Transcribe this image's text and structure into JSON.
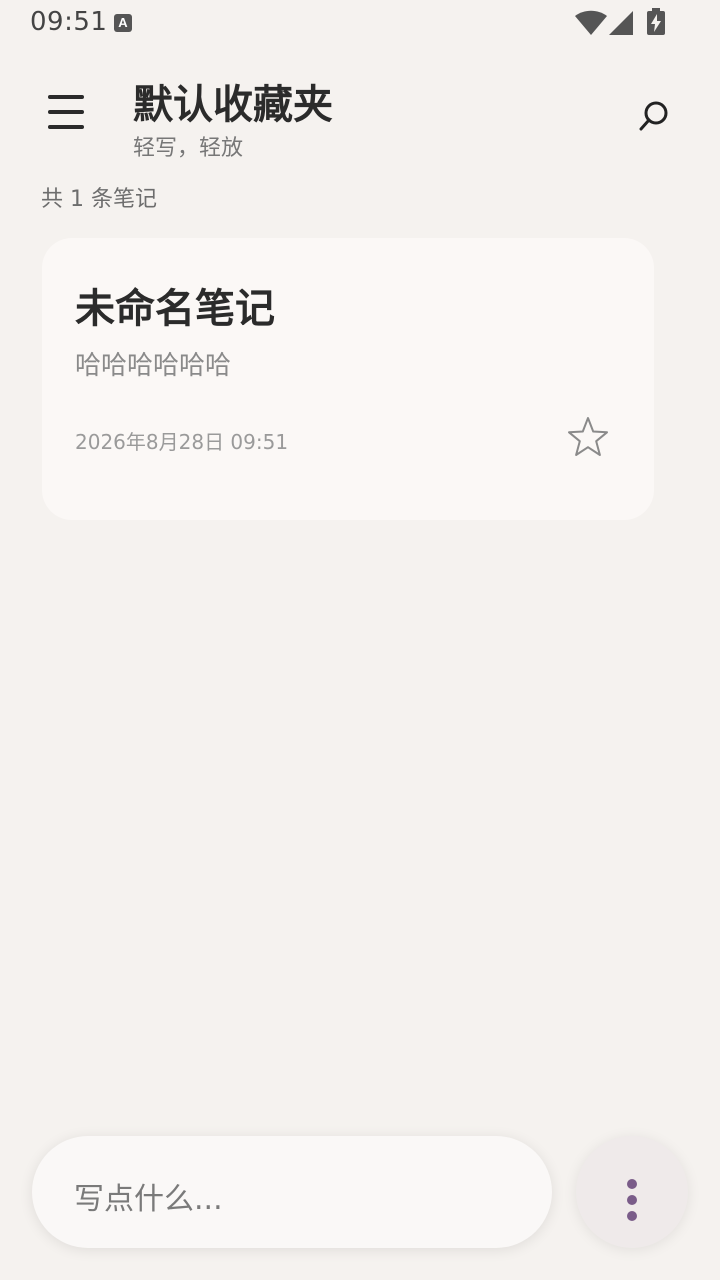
{
  "status_bar": {
    "time": "09:51",
    "notification_icon_letter": "A",
    "icons": [
      "wifi-icon",
      "signal-icon",
      "battery-charging-icon"
    ]
  },
  "header": {
    "title": "默认收藏夹",
    "subtitle": "轻写，轻放",
    "menu_icon": "hamburger-menu-icon",
    "search_icon": "search-icon"
  },
  "list": {
    "count_text": "共 1 条笔记",
    "notes": [
      {
        "title": "未命名笔记",
        "preview": "哈哈哈哈哈哈",
        "date": "2026年8月28日 09:51",
        "favorite": false,
        "favorite_icon": "star-outline-icon"
      }
    ]
  },
  "composer": {
    "placeholder": "写点什么...",
    "more_icon": "more-vertical-icon"
  },
  "colors": {
    "background": "#f5f2ef",
    "card": "#fbf8f6",
    "accent": "#7a5c89"
  }
}
